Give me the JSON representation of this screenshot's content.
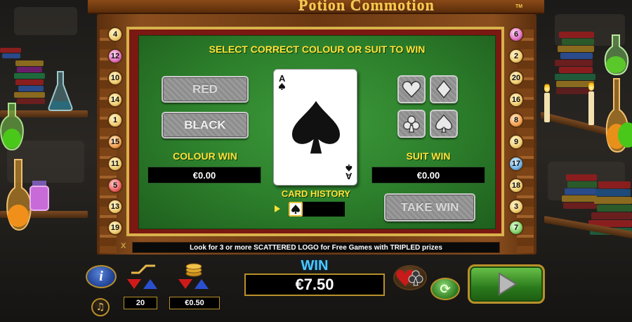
{
  "header": {
    "logo_text": "Potion Commotion",
    "tm": "TM"
  },
  "paylines": {
    "left": [
      "4",
      "12",
      "10",
      "14",
      "1",
      "15",
      "11",
      "5",
      "13",
      "19"
    ],
    "right": [
      "6",
      "2",
      "20",
      "16",
      "8",
      "9",
      "17",
      "18",
      "3",
      "7"
    ]
  },
  "gamble": {
    "title": "SELECT CORRECT COLOUR OR SUIT TO WIN",
    "red_label": "RED",
    "black_label": "BLACK",
    "colour_win_label": "COLOUR WIN",
    "colour_win_value": "€0.00",
    "suit_win_label": "SUIT WIN",
    "suit_win_value": "€0.00",
    "card_history_label": "CARD HISTORY",
    "take_win_label": "TAKE WIN",
    "card": {
      "rank": "A",
      "suit": "spades"
    },
    "suits": [
      "hearts",
      "diamonds",
      "clubs",
      "spades"
    ],
    "history": [
      "spades"
    ]
  },
  "info_strip": {
    "marker": "X",
    "text": "Look for 3 or more SCATTERED LOGO for Free Games with TRIPLED prizes"
  },
  "controls": {
    "info_symbol": "i",
    "sound_symbol": "♫",
    "lines_value": "20",
    "bet_value": "€0.50",
    "win_label": "WIN",
    "win_value": "€7.50",
    "autoplay_symbol": "⟳"
  },
  "colors": {
    "felt": "#2c7e2b",
    "gold": "#d7b24a",
    "label_yellow": "#ffe23a",
    "win_blue": "#4cc8ff"
  }
}
